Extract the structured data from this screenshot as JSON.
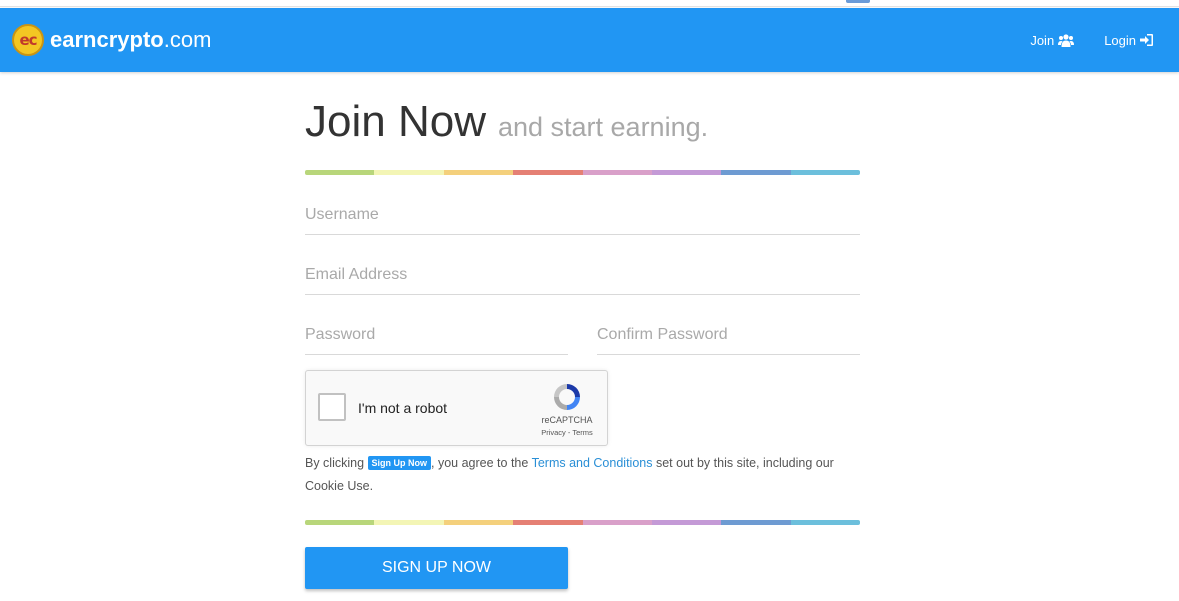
{
  "brand": {
    "logo_text": "ec",
    "name_bold": "earncrypto",
    "name_domain": ".com"
  },
  "nav": {
    "join": "Join",
    "login": "Login"
  },
  "heading": {
    "main": "Join Now",
    "sub": "and start earning."
  },
  "rainbow": [
    "#b8d67a",
    "#f3f5b5",
    "#f4d07c",
    "#e58074",
    "#d9a0c9",
    "#c49ad6",
    "#6e9bd2",
    "#6cbfdc"
  ],
  "fields": {
    "username": {
      "placeholder": "Username"
    },
    "email": {
      "placeholder": "Email Address"
    },
    "password": {
      "placeholder": "Password"
    },
    "confirm": {
      "placeholder": "Confirm Password"
    }
  },
  "captcha": {
    "label": "I'm not a robot",
    "brand": "reCAPTCHA",
    "terms": "Privacy - Terms"
  },
  "agree": {
    "prefix": "By clicking",
    "badge": "Sign Up Now",
    "middle": ", you agree to the",
    "link": "Terms and Conditions",
    "suffix": "set out by this site, including our Cookie Use."
  },
  "signup_label": "SIGN UP NOW",
  "colors": {
    "primary": "#2196f3",
    "link": "#2a8fd6"
  }
}
